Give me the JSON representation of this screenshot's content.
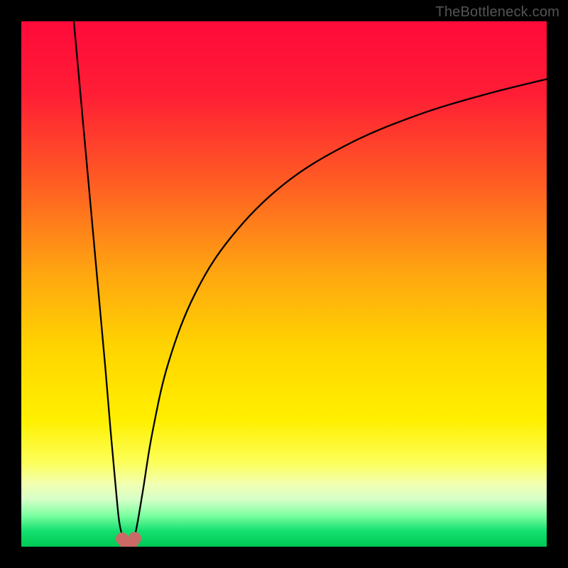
{
  "watermark": "TheBottleneck.com",
  "gradient_stops": [
    {
      "pct": 0,
      "color": "#ff0a3a"
    },
    {
      "pct": 14,
      "color": "#ff1e35"
    },
    {
      "pct": 30,
      "color": "#ff5a24"
    },
    {
      "pct": 48,
      "color": "#ffa610"
    },
    {
      "pct": 62,
      "color": "#ffd400"
    },
    {
      "pct": 76,
      "color": "#fff000"
    },
    {
      "pct": 84,
      "color": "#fcff5a"
    },
    {
      "pct": 88,
      "color": "#f2ffb0"
    },
    {
      "pct": 91,
      "color": "#d6ffc8"
    },
    {
      "pct": 94,
      "color": "#7effa0"
    },
    {
      "pct": 97,
      "color": "#14e070"
    },
    {
      "pct": 100,
      "color": "#00c853"
    }
  ],
  "marker_color": "#c96a66",
  "curve_color": "#000000",
  "chart_data": {
    "type": "line",
    "title": "",
    "xlabel": "",
    "ylabel": "",
    "xlim": [
      0,
      100
    ],
    "ylim": [
      0,
      100
    ],
    "grid": false,
    "legend": false,
    "series": [
      {
        "name": "left-branch",
        "x": [
          10.0,
          12.0,
          14.0,
          16.0,
          17.0,
          18.0,
          18.6,
          19.2
        ],
        "y": [
          100.0,
          78.0,
          56.0,
          34.0,
          22.0,
          11.0,
          5.0,
          2.0
        ]
      },
      {
        "name": "right-branch",
        "x": [
          21.6,
          22.2,
          23.2,
          25.0,
          28.0,
          33.0,
          40.0,
          50.0,
          62.0,
          75.0,
          88.0,
          100.0
        ],
        "y": [
          2.0,
          5.0,
          11.0,
          22.0,
          35.0,
          48.0,
          59.0,
          69.0,
          76.5,
          82.0,
          86.0,
          89.0
        ]
      }
    ],
    "markers": {
      "name": "valley-markers",
      "color": "#c96a66",
      "points": [
        {
          "x": 19.2,
          "y": 1.5
        },
        {
          "x": 19.8,
          "y": 0.9
        },
        {
          "x": 20.5,
          "y": 0.7
        },
        {
          "x": 21.2,
          "y": 1.0
        },
        {
          "x": 21.6,
          "y": 1.6
        }
      ]
    }
  }
}
